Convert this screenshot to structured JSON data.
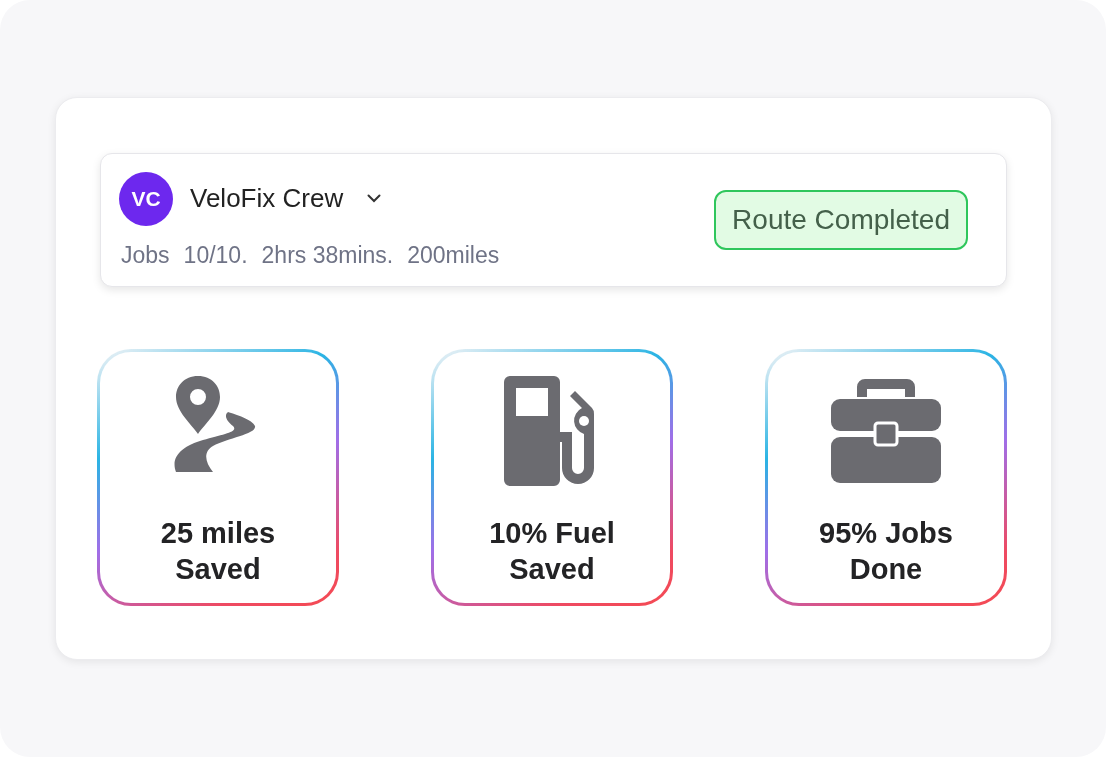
{
  "crew": {
    "initials": "VC",
    "name": "VeloFix Crew",
    "meta": [
      "Jobs",
      "10/10.",
      "2hrs 38mins.",
      "200miles"
    ],
    "status": "Route Completed"
  },
  "stats": [
    {
      "kind": "route",
      "label": "25 miles Saved"
    },
    {
      "kind": "fuel",
      "label": "10% Fuel Saved"
    },
    {
      "kind": "toolbox",
      "label": "95% Jobs Done"
    }
  ]
}
